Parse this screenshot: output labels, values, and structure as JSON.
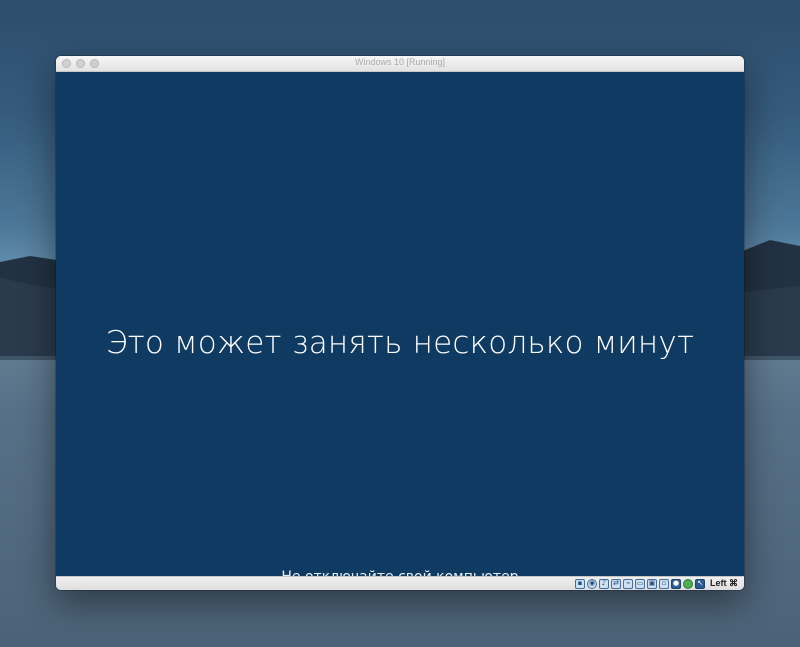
{
  "window": {
    "title": "Windows 10 [Running]"
  },
  "vm_screen": {
    "main_message": "Это может занять несколько минут",
    "sub_message": "Не отключайте свой компьютер"
  },
  "statusbar": {
    "icons": [
      "hard-disk-icon",
      "optical-drive-icon",
      "audio-icon",
      "network-icon",
      "usb-icon",
      "shared-folders-icon",
      "display-icon",
      "video-capture-icon",
      "recording-icon",
      "cpu-activity-icon",
      "mouse-integration-icon"
    ],
    "host_key": "Left ⌘"
  },
  "colors": {
    "vm_background": "#0f3a62",
    "text": "#ffffff"
  }
}
